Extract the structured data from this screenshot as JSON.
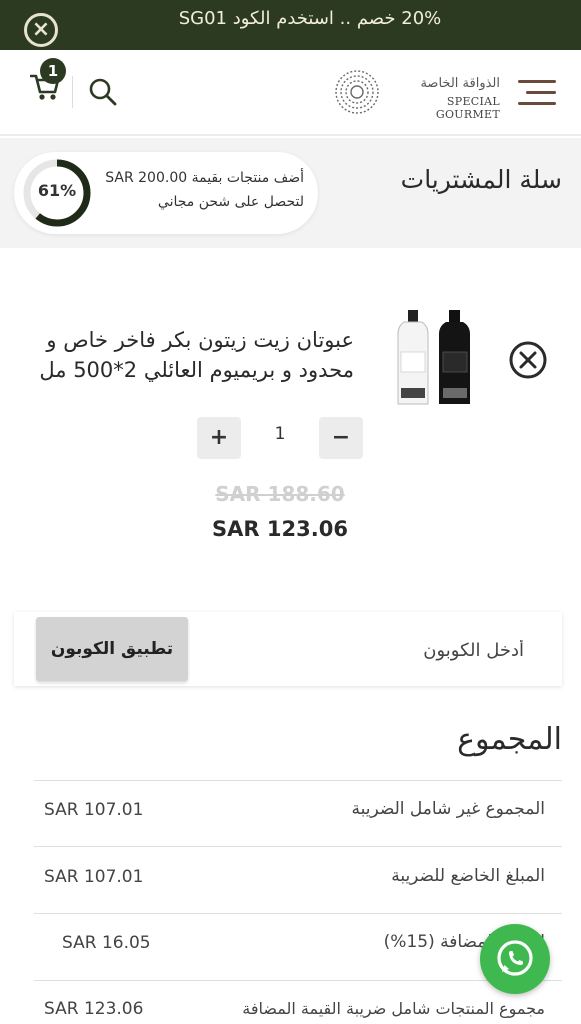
{
  "promo": {
    "text": "20% خصم .. استخدم الكود SG01",
    "close_icon": "close-icon"
  },
  "header": {
    "cart_badge": "1",
    "logo_ar": "الذواقة الخاصة",
    "logo_en": "SPECIAL GOURMET",
    "icons": [
      "cart-icon",
      "search-icon",
      "logo-icon",
      "menu-icon"
    ]
  },
  "cart": {
    "title": "سلة المشتريات",
    "shipping_line1": "أضف منتجات بقيمة SAR 200.00",
    "shipping_line2": "لتحصل على شحن مجاني",
    "progress_label": "61%",
    "progress": 0.61
  },
  "item": {
    "name": "عبوتان زيت زيتون بكر فاخر خاص و محدود و بريميوم العائلي 2*500 مل",
    "quantity": "1",
    "minus_label": "−",
    "plus_label": "+",
    "price_old": "SAR 188.60",
    "price_new": "SAR 123.06"
  },
  "coupon": {
    "placeholder": "أدخل الكوبون",
    "button": "تطبيق الكوبون"
  },
  "totals": {
    "title": "المجموع",
    "rows": [
      {
        "label": "المجموع غير شامل الضريبة",
        "value": "SAR 107.01"
      },
      {
        "label": "المبلغ الخاضع للضريبة",
        "value": "SAR 107.01"
      },
      {
        "label": "القيمة المضافة (15%)",
        "value": "SAR 16.05"
      },
      {
        "label": "مجموع المنتجات شامل ضريبة القيمة المضافة",
        "value": "SAR 123.06"
      }
    ]
  },
  "colors": {
    "dark_green": "#2c3a22",
    "whatsapp": "#3fb94f",
    "ring_dark": "#1f2b18",
    "menu_brown": "#6b4a3a"
  }
}
